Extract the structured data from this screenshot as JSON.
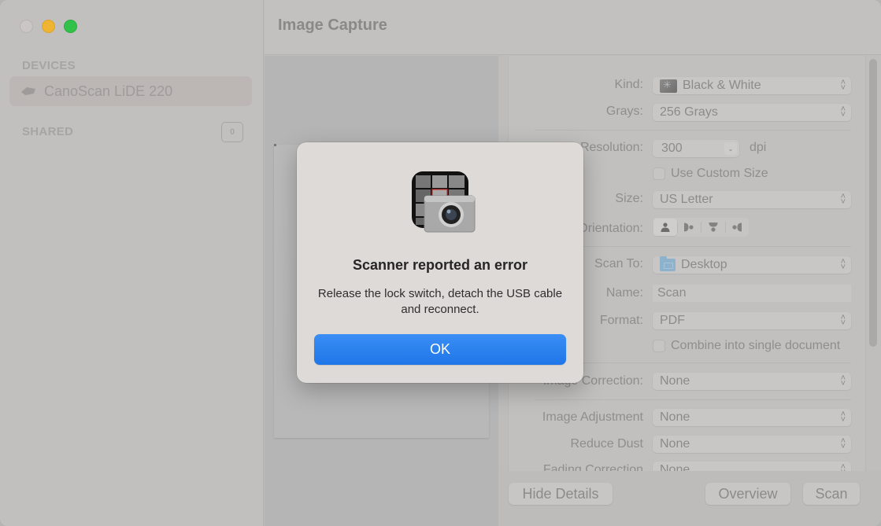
{
  "window": {
    "title": "Image Capture",
    "traffic_lights": [
      "close",
      "minimize",
      "maximize"
    ]
  },
  "sidebar": {
    "devices_header": "DEVICES",
    "devices": [
      {
        "label": "CanoScan LiDE 220",
        "icon": "scanner-icon",
        "selected": true
      }
    ],
    "shared_header": "SHARED",
    "shared_count": "0"
  },
  "details": {
    "kind": {
      "label": "Kind:",
      "value": "Black & White"
    },
    "grays": {
      "label": "Grays:",
      "value": "256 Grays"
    },
    "resolution": {
      "label": "Resolution:",
      "value": "300",
      "unit": "dpi"
    },
    "custom_size": {
      "label": "Use Custom Size",
      "checked": false
    },
    "size": {
      "label": "Size:",
      "value": "US Letter"
    },
    "orientation": {
      "label": "Orientation:",
      "options": [
        "portrait",
        "landscape-left",
        "portrait-flipped",
        "landscape-right"
      ],
      "selected": "portrait"
    },
    "scan_to": {
      "label": "Scan To:",
      "value": "Desktop"
    },
    "name": {
      "label": "Name:",
      "value": "Scan"
    },
    "format": {
      "label": "Format:",
      "value": "PDF"
    },
    "combine": {
      "label": "Combine into single document",
      "checked": false
    },
    "image_correction": {
      "label": "Image Correction:",
      "value": "None"
    },
    "image_adjustment": {
      "label": "Image Adjustment",
      "value": "None"
    },
    "reduce_dust": {
      "label": "Reduce Dust",
      "value": "None"
    },
    "fading_correction": {
      "label": "Fading Correction",
      "value": "None"
    }
  },
  "buttons": {
    "hide_details": "Hide Details",
    "overview": "Overview",
    "scan": "Scan"
  },
  "alert": {
    "title": "Scanner reported an error",
    "message": "Release the lock switch, detach the USB cable and reconnect.",
    "ok_label": "OK",
    "icon": "image-capture-app-icon",
    "accent_color": "#1f76e8"
  }
}
